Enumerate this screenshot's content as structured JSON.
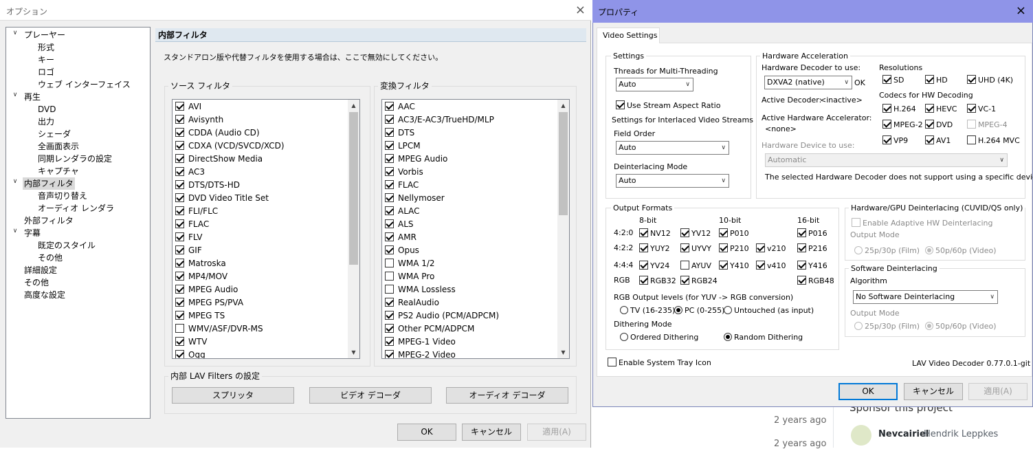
{
  "options": {
    "title": "オプション",
    "close": "×",
    "tree": [
      {
        "label": "プレーヤー",
        "level": 0,
        "expand": "∨"
      },
      {
        "label": "形式",
        "level": 1
      },
      {
        "label": "キー",
        "level": 1
      },
      {
        "label": "ロゴ",
        "level": 1
      },
      {
        "label": "ウェブ インターフェイス",
        "level": 1
      },
      {
        "label": "再生",
        "level": 0,
        "expand": "∨"
      },
      {
        "label": "DVD",
        "level": 1
      },
      {
        "label": "出力",
        "level": 1
      },
      {
        "label": "シェーダ",
        "level": 1
      },
      {
        "label": "全画面表示",
        "level": 1
      },
      {
        "label": "同期レンダラの設定",
        "level": 1
      },
      {
        "label": "キャプチャ",
        "level": 1
      },
      {
        "label": "内部フィルタ",
        "level": 0,
        "expand": "∨",
        "selected": true
      },
      {
        "label": "音声切り替え",
        "level": 1
      },
      {
        "label": "オーディオ レンダラ",
        "level": 1
      },
      {
        "label": "外部フィルタ",
        "level": 0
      },
      {
        "label": "字幕",
        "level": 0,
        "expand": "∨"
      },
      {
        "label": "既定のスタイル",
        "level": 1
      },
      {
        "label": "その他",
        "level": 1
      },
      {
        "label": "詳細設定",
        "level": 0
      },
      {
        "label": "その他",
        "level": 0
      },
      {
        "label": "高度な設定",
        "level": 0
      }
    ],
    "header": "内部フィルタ",
    "description": "スタンドアロン版や代替フィルタを使用する場合は、ここで無効にしてください。",
    "source_group": "ソース フィルタ",
    "source_filters": [
      {
        "label": "AVI",
        "checked": true
      },
      {
        "label": "Avisynth",
        "checked": true
      },
      {
        "label": "CDDA (Audio CD)",
        "checked": true
      },
      {
        "label": "CDXA (VCD/SVCD/XCD)",
        "checked": true
      },
      {
        "label": "DirectShow Media",
        "checked": true
      },
      {
        "label": "AC3",
        "checked": true
      },
      {
        "label": "DTS/DTS-HD",
        "checked": true
      },
      {
        "label": "DVD Video Title Set",
        "checked": true
      },
      {
        "label": "FLI/FLC",
        "checked": true
      },
      {
        "label": "FLAC",
        "checked": true
      },
      {
        "label": "FLV",
        "checked": true
      },
      {
        "label": "GIF",
        "checked": true
      },
      {
        "label": "Matroska",
        "checked": true
      },
      {
        "label": "MP4/MOV",
        "checked": true
      },
      {
        "label": "MPEG Audio",
        "checked": true
      },
      {
        "label": "MPEG PS/PVA",
        "checked": true
      },
      {
        "label": "MPEG TS",
        "checked": true
      },
      {
        "label": "WMV/ASF/DVR-MS",
        "checked": false
      },
      {
        "label": "WTV",
        "checked": true
      },
      {
        "label": "Ogg",
        "checked": true
      }
    ],
    "transform_group": "変換フィルタ",
    "transform_filters": [
      {
        "label": "AAC",
        "checked": true
      },
      {
        "label": "AC3/E-AC3/TrueHD/MLP",
        "checked": true
      },
      {
        "label": "DTS",
        "checked": true
      },
      {
        "label": "LPCM",
        "checked": true
      },
      {
        "label": "MPEG Audio",
        "checked": true
      },
      {
        "label": "Vorbis",
        "checked": true
      },
      {
        "label": "FLAC",
        "checked": true
      },
      {
        "label": "Nellymoser",
        "checked": true
      },
      {
        "label": "ALAC",
        "checked": true
      },
      {
        "label": "ALS",
        "checked": true
      },
      {
        "label": "AMR",
        "checked": true
      },
      {
        "label": "Opus",
        "checked": true
      },
      {
        "label": "WMA 1/2",
        "checked": false
      },
      {
        "label": "WMA Pro",
        "checked": false
      },
      {
        "label": "WMA Lossless",
        "checked": false
      },
      {
        "label": "RealAudio",
        "checked": true
      },
      {
        "label": "PS2 Audio (PCM/ADPCM)",
        "checked": true
      },
      {
        "label": "Other PCM/ADPCM",
        "checked": true
      },
      {
        "label": "MPEG-1 Video",
        "checked": true
      },
      {
        "label": "MPEG-2 Video",
        "checked": true
      }
    ],
    "lav_group": "内部 LAV Filters の設定",
    "lav_buttons": [
      "スプリッタ",
      "ビデオ デコーダ",
      "オーディオ デコーダ"
    ],
    "ok": "OK",
    "cancel": "キャンセル",
    "apply": "適用(A)"
  },
  "props": {
    "title": "プロパティ",
    "close": "×",
    "tab": "Video Settings",
    "settings_group": "Settings",
    "threads_label": "Threads for Multi-Threading",
    "threads_value": "Auto",
    "aspect_label": "Use Stream Aspect Ratio",
    "interlaced_label": "Settings for Interlaced Video Streams",
    "field_order_label": "Field Order",
    "field_order_value": "Auto",
    "deint_mode_label": "Deinterlacing Mode",
    "deint_mode_value": "Auto",
    "hw_group": "Hardware Acceleration",
    "hw_decoder_label": "Hardware Decoder to use:",
    "hw_decoder_value": "DXVA2 (native)",
    "hw_ok": "OK",
    "active_decoder_label": "Active Decoder:",
    "active_decoder_value": "<inactive>",
    "active_accel_label": "Active Hardware Accelerator:",
    "active_accel_value": "<none>",
    "hw_device_label": "Hardware Device to use:",
    "hw_device_value": "Automatic",
    "hw_note": "The selected Hardware Decoder does not support using a specific device.",
    "resolutions_label": "Resolutions",
    "resolutions": [
      {
        "label": "SD",
        "checked": true
      },
      {
        "label": "HD",
        "checked": true
      },
      {
        "label": "UHD (4K)",
        "checked": true
      }
    ],
    "codecs_label": "Codecs for HW Decoding",
    "codecs": [
      {
        "label": "H.264",
        "checked": true
      },
      {
        "label": "HEVC",
        "checked": true
      },
      {
        "label": "VC-1",
        "checked": true
      },
      {
        "label": "MPEG-2",
        "checked": true
      },
      {
        "label": "DVD",
        "checked": true
      },
      {
        "label": "MPEG-4",
        "checked": false,
        "disabled": true
      },
      {
        "label": "VP9",
        "checked": true
      },
      {
        "label": "AV1",
        "checked": true
      },
      {
        "label": "H.264 MVC",
        "checked": false
      }
    ],
    "output_group": "Output Formats",
    "bit8": "8-bit",
    "bit10": "10-bit",
    "bit16": "16-bit",
    "rows": [
      {
        "label": "4:2:0",
        "items": [
          {
            "label": "NV12",
            "checked": true
          },
          {
            "label": "YV12",
            "checked": true
          },
          {
            "label": "P010",
            "checked": true
          },
          null,
          {
            "label": "P016",
            "checked": true
          }
        ]
      },
      {
        "label": "4:2:2",
        "items": [
          {
            "label": "YUY2",
            "checked": true
          },
          {
            "label": "UYVY",
            "checked": true
          },
          {
            "label": "P210",
            "checked": true
          },
          {
            "label": "v210",
            "checked": true
          },
          {
            "label": "P216",
            "checked": true
          }
        ]
      },
      {
        "label": "4:4:4",
        "items": [
          {
            "label": "YV24",
            "checked": true
          },
          {
            "label": "AYUV",
            "checked": false
          },
          {
            "label": "Y410",
            "checked": true
          },
          {
            "label": "v410",
            "checked": true
          },
          {
            "label": "Y416",
            "checked": true
          }
        ]
      },
      {
        "label": "RGB",
        "items": [
          {
            "label": "RGB32",
            "checked": true
          },
          {
            "label": "RGB24",
            "checked": true
          },
          null,
          null,
          {
            "label": "RGB48",
            "checked": true
          }
        ]
      }
    ],
    "rgb_levels_label": "RGB Output levels (for YUV -> RGB conversion)",
    "rgb_levels": [
      {
        "label": "TV (16-235)",
        "on": false
      },
      {
        "label": "PC (0-255)",
        "on": true
      },
      {
        "label": "Untouched (as input)",
        "on": false
      }
    ],
    "dither_label": "Dithering Mode",
    "dither": [
      {
        "label": "Ordered Dithering",
        "on": false
      },
      {
        "label": "Random Dithering",
        "on": true
      }
    ],
    "gpu_group": "Hardware/GPU Deinterlacing (CUVID/QS only)",
    "adaptive_label": "Enable Adaptive HW Deinterlacing",
    "output_mode": "Output Mode",
    "film": "25p/30p (Film)",
    "video": "50p/60p (Video)",
    "sw_group": "Software Deinterlacing",
    "algorithm_label": "Algorithm",
    "algorithm_value": "No Software Deinterlacing",
    "tray_label": "Enable System Tray Icon",
    "version": "LAV Video Decoder 0.77.0.1-git",
    "ok": "OK",
    "cancel": "キャンセル",
    "apply": "適用(A)"
  },
  "web": {
    "sponsor": "Sponsor this project",
    "ago1": "2 years ago",
    "ago2": "2 years ago",
    "user1": "Nevcairiel",
    "user2": "Hendrik Leppkes"
  }
}
